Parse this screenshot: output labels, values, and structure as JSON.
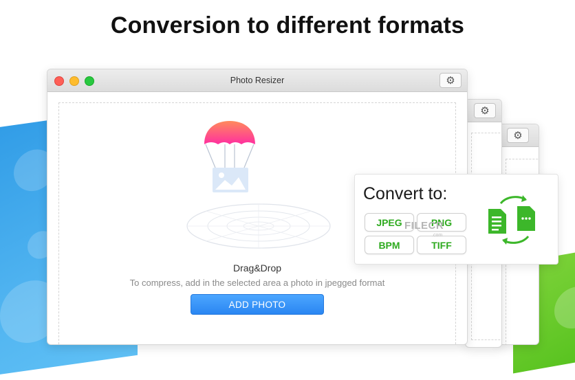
{
  "headline": "Conversion to different formats",
  "window": {
    "title": "Photo Resizer",
    "drop_label": "Drag&Drop",
    "drop_hint": "To compress, add in the selected area a photo in jpegged format",
    "add_button": "ADD PHOTO"
  },
  "convert": {
    "title": "Convert to:",
    "formats": [
      "JPEG",
      "PNG",
      "BPM",
      "TIFF"
    ],
    "watermark": "FILECR",
    "watermark_sub": ".com"
  },
  "colors": {
    "accent_blue": "#2a86f2",
    "format_green": "#2eaa1f",
    "traffic_red": "#fe5f57",
    "traffic_yellow": "#febc2e",
    "traffic_green": "#28c840"
  },
  "icons": [
    "gear-icon",
    "parachute-icon",
    "photo-icon",
    "portal-icon",
    "convert-files-icon"
  ]
}
